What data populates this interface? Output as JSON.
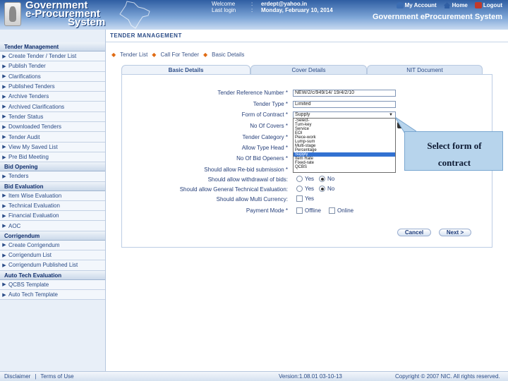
{
  "header": {
    "logo_line1": "Government",
    "logo_line2": "e-Procurement",
    "logo_line3": "System",
    "welcome_label": "Welcome",
    "welcome_value": "erdept@yahoo.in",
    "lastlogin_label": "Last login",
    "lastlogin_value": "Monday, February 10, 2014",
    "colon": ":",
    "my_account": "My Account",
    "home": "Home",
    "logout": "Logout",
    "system_title": "Government eProcurement System"
  },
  "sidebar": {
    "sections": [
      {
        "title": "Tender Management",
        "items": [
          "Create Tender / Tender List",
          "Publish Tender",
          "Clarifications",
          "Published Tenders",
          "Archive Tenders",
          "Archived Clarifications",
          "Tender Status",
          "Downloaded Tenders",
          "Tender Audit",
          "View My Saved List",
          "Pre Bid Meeting"
        ]
      },
      {
        "title": "Bid Opening",
        "items": [
          "Tenders"
        ]
      },
      {
        "title": "Bid Evaluation",
        "items": [
          "Item Wise Evaluation",
          "Technical Evaluation",
          "Financial Evaluation",
          "AOC"
        ]
      },
      {
        "title": "Corrigendum",
        "items": [
          "Create Corrigendum",
          "Corrigendum List",
          "Corrigendum Published List"
        ]
      },
      {
        "title": "Auto Tech Evaluation",
        "items": [
          "QCBS Template",
          "Auto Tech Template"
        ]
      }
    ]
  },
  "main": {
    "page_title": "TENDER MANAGEMENT",
    "breadcrumb": [
      "Tender List",
      "Call For Tender",
      "Basic Details"
    ],
    "tabs": [
      "Basic Details",
      "Cover Details",
      "NIT Document"
    ]
  },
  "form": {
    "tender_ref_label": "Tender Reference Number *",
    "tender_ref_value": "NEW/2/c/949/14/ 19/4/2/10",
    "tender_type_label": "Tender Type *",
    "tender_type_value": "Limited",
    "form_contract_label": "Form of Contract *",
    "form_contract_value": "Supply",
    "no_covers_label": "No Of Covers *",
    "tender_category_label": "Tender Category *",
    "alloc_type_label": "Allow Type Head *",
    "no_bid_openers_label": "No Of Bid Openers *",
    "rebid_label": "Should allow Re-bid submission *",
    "withdrawal_label": "Should allow withdrawal of bids:",
    "general_tech_label": "Should allow General Technical Evaluation:",
    "multi_currency_label": "Should allow Multi Currency:",
    "payment_mode_label": "Payment Mode *",
    "yes": "Yes",
    "no": "No",
    "offline": "Offline",
    "online": "Online",
    "dropdown_options": [
      "-Select-",
      "Turn-key",
      "Service",
      "QCBS",
      "Fixed-rate",
      "Item Rate",
      "Supply",
      "Percentage",
      "Multi-stage",
      "Lump-sum",
      "Piece-work",
      "EOI",
      "Service",
      "Turn-key",
      "-Select-"
    ],
    "dropdown_selected": "Supply"
  },
  "buttons": {
    "cancel": "Cancel",
    "next": "Next >"
  },
  "callout": {
    "line1": "Select form of",
    "line2": "contract"
  },
  "footer": {
    "disclaimer": "Disclaimer",
    "divider": "|",
    "terms": "Terms of Use",
    "version": "Version:1.08.01 03-10-13",
    "copyright": "Copyright © 2007 NIC. All rights reserved."
  },
  "colors": {
    "header_blue": "#2f5ea3",
    "selected_option": "#3271d1",
    "callout_fill": "#b7d4ec"
  }
}
